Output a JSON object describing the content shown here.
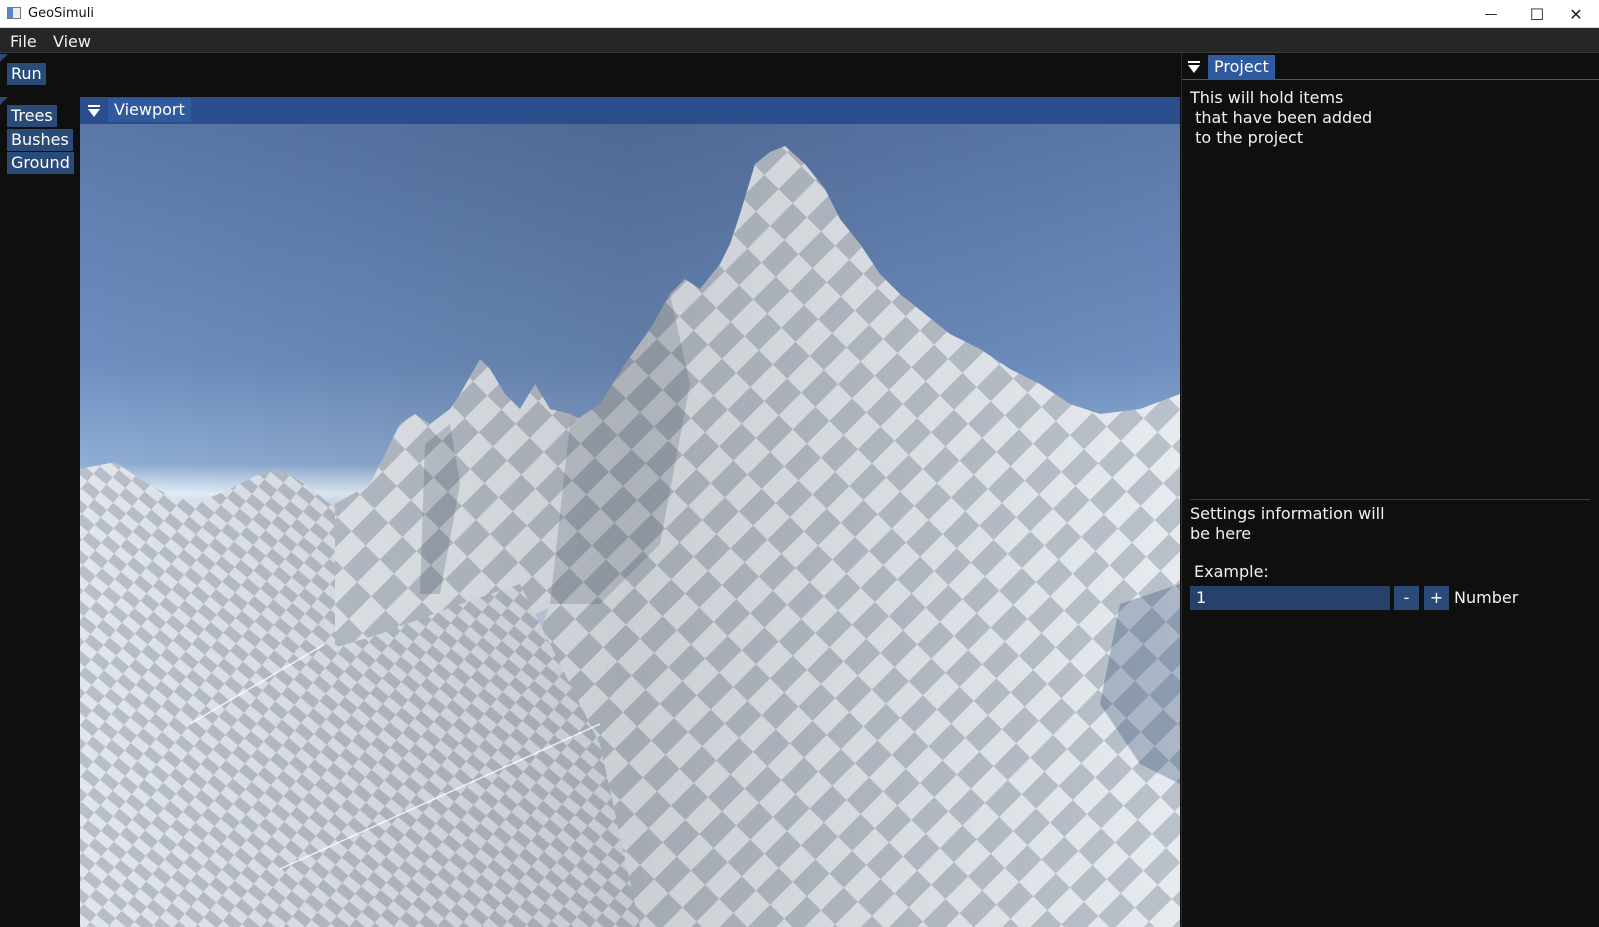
{
  "window": {
    "title": "GeoSimuli",
    "minimize_glyph": "—",
    "maximize_glyph": "☐",
    "close_glyph": "✕",
    "icon": "app-window-icon"
  },
  "menu": {
    "file": "File",
    "view": "View"
  },
  "toolbar": {
    "run_label": "Run"
  },
  "sidebar": {
    "items": [
      {
        "label": "Trees"
      },
      {
        "label": "Bushes"
      },
      {
        "label": "Ground"
      }
    ]
  },
  "viewport": {
    "tab_label": "Viewport",
    "icon": "collapse-triangle-icon",
    "scene": "3d-terrain-render"
  },
  "project": {
    "tab_label": "Project",
    "description": "This will hold items\n that have been added\n to the project",
    "settings_text": "Settings information will\nbe here",
    "example_label": "Example:",
    "number_value": "1",
    "minus_label": "-",
    "plus_label": "+",
    "number_label": "Number"
  },
  "colors": {
    "accent": "#2a4b78",
    "header": "#2a4d8c",
    "background": "#0f0f0f"
  }
}
